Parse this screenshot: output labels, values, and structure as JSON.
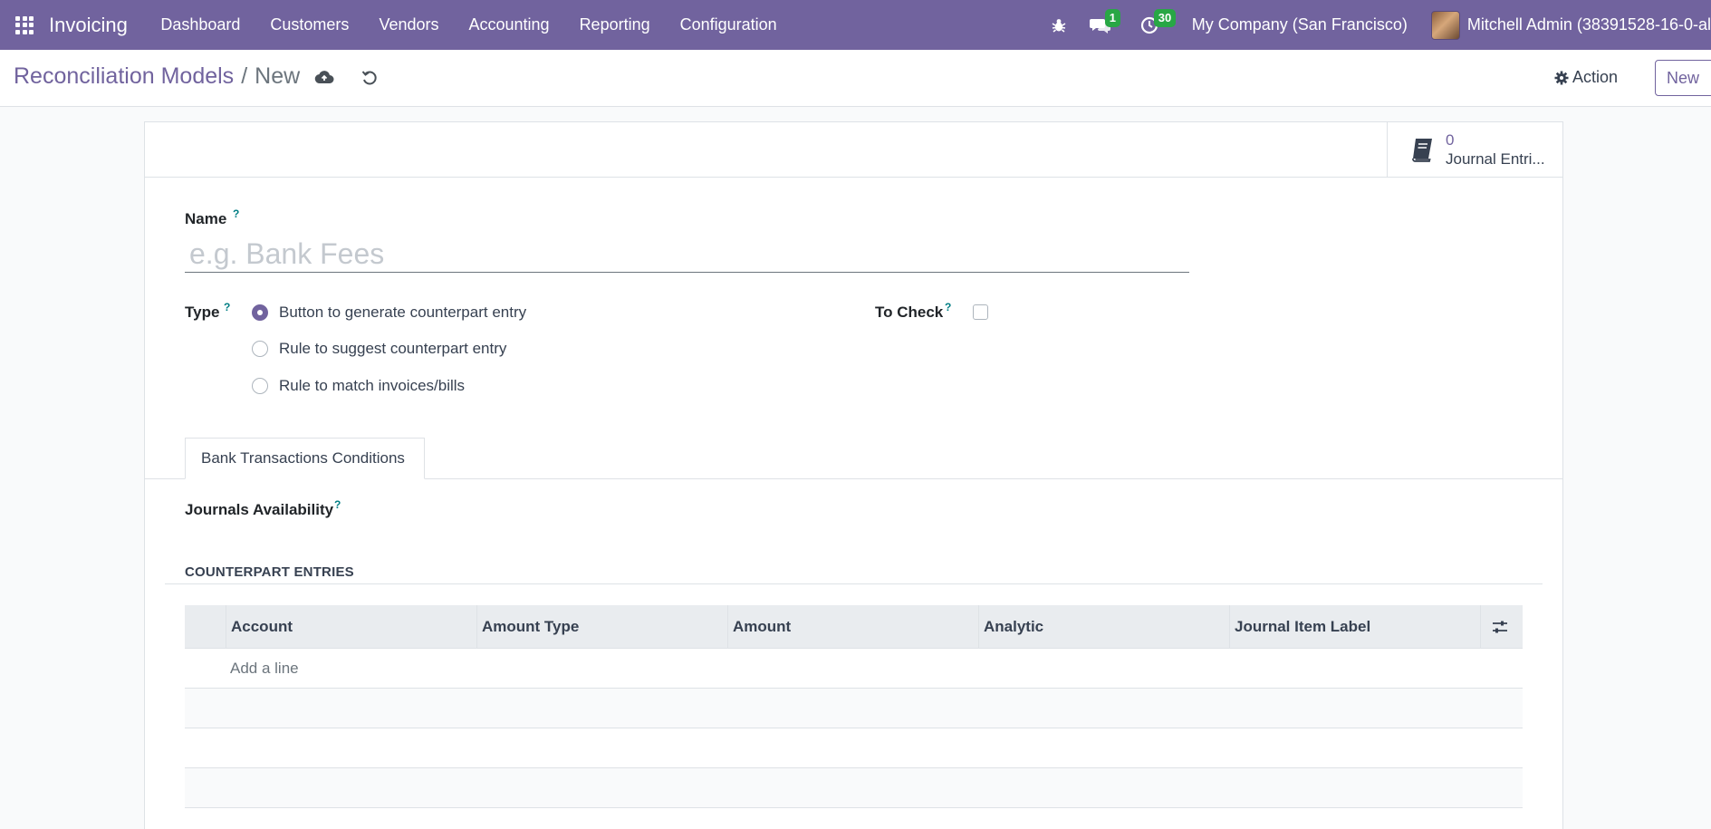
{
  "navbar": {
    "app_name": "Invoicing",
    "menu": [
      "Dashboard",
      "Customers",
      "Vendors",
      "Accounting",
      "Reporting",
      "Configuration"
    ],
    "messages_count": "1",
    "activities_count": "30",
    "company": "My Company (San Francisco)",
    "user": "Mitchell Admin (38391528-16-0-al"
  },
  "control_panel": {
    "breadcrumb_parent": "Reconciliation Models",
    "breadcrumb_separator": "/",
    "breadcrumb_current": "New",
    "action_label": "Action",
    "new_label": "New"
  },
  "stat_button": {
    "value": "0",
    "label": "Journal Entri..."
  },
  "form": {
    "name_label": "Name",
    "name_placeholder": "e.g. Bank Fees",
    "help_mark": "?",
    "type_label": "Type",
    "type_options": [
      {
        "label": "Button to generate counterpart entry",
        "checked": true
      },
      {
        "label": "Rule to suggest counterpart entry",
        "checked": false
      },
      {
        "label": "Rule to match invoices/bills",
        "checked": false
      }
    ],
    "to_check_label": "To Check",
    "to_check_value": false
  },
  "tabs": [
    "Bank Transactions Conditions"
  ],
  "journals_label": "Journals Availability",
  "counterpart": {
    "section_title": "COUNTERPART ENTRIES",
    "columns": [
      "Account",
      "Amount Type",
      "Amount",
      "Analytic",
      "Journal Item Label"
    ],
    "add_line": "Add a line"
  },
  "colors": {
    "brand": "#71639e",
    "badge": "#28a745",
    "help": "#017e84"
  }
}
